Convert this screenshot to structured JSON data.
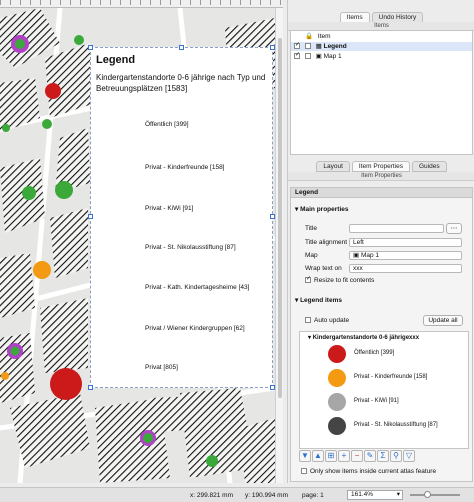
{
  "colors": {
    "red": "#cc1a1a",
    "orange": "#f39a12",
    "grey": "#a6a6a6",
    "dark": "#444444",
    "purple": "#b042c8",
    "green": "#3aa93a",
    "handle": "#3a72d8"
  },
  "layout_legend": {
    "heading": "Legend",
    "subtitle": "Kindergartenstandorte 0-6 jährige nach Typ und Betreuungsplätzen [1583]",
    "labels": [
      "Öffentlich [399]",
      "Privat - Kinderfreunde [158]",
      "Privat - KiWi [91]",
      "Privat - St. Nikolausstiftung [87]",
      "Privat - Kath. Kindertagesheime [43]",
      "Privat / Wiener Kindergruppen [62]",
      "Privat [805]"
    ]
  },
  "top_tabs": [
    "Items",
    "Undo History"
  ],
  "items_panel": {
    "title": "Items",
    "column": "Item",
    "rows": [
      "Legend",
      "Map 1"
    ]
  },
  "middle_tabs": [
    "Layout",
    "Item Properties",
    "Guides"
  ],
  "item_properties": {
    "title": "Item Properties",
    "section_header": "Legend",
    "main_properties": "Main properties",
    "title_label": "Title",
    "title_value": "",
    "title_alignment_label": "Title alignment",
    "title_alignment_value": "Left",
    "map_label": "Map",
    "map_value": "Map 1",
    "wrap_label": "Wrap text on",
    "wrap_value": "xxx",
    "resize_label": "Resize to fit contents",
    "legend_items": "Legend items",
    "auto_update": "Auto update",
    "update_all": "Update all",
    "group": "Kindergartenstandorte 0-6 jährigexxx",
    "entries": [
      "Öffentlich [399]",
      "Privat - Kinderfreunde [158]",
      "Privat - KiWi [91]",
      "Privat - St. Nikolausstiftung [87]"
    ],
    "only_show": "Only show items inside current atlas feature"
  },
  "status": {
    "x": "x: 299.821 mm",
    "y": "y: 190.994 mm",
    "page": "page: 1",
    "zoom": "161.4%"
  }
}
